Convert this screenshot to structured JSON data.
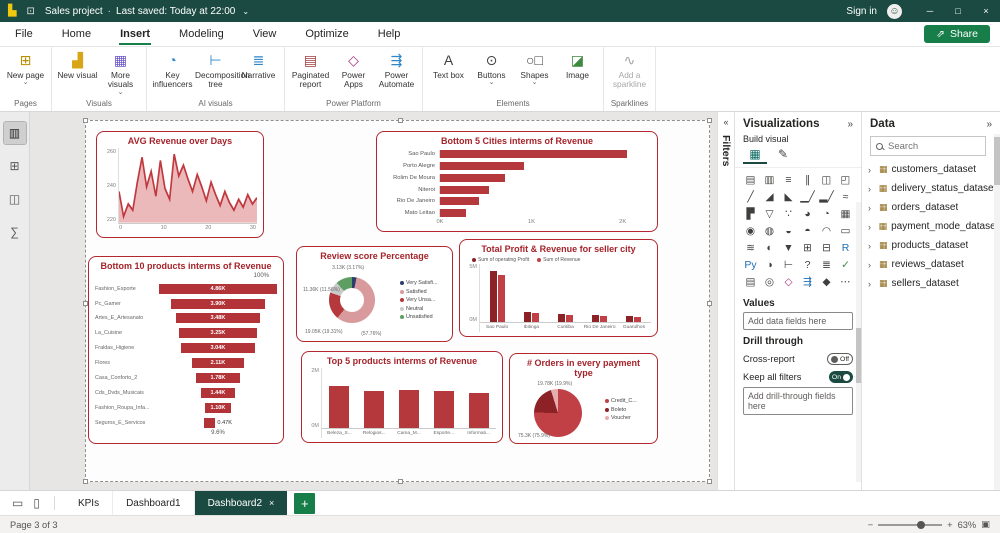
{
  "titlebar": {
    "app_title": "Sales project",
    "separator": "·",
    "autosave_text": "Last saved: Today at 22:00",
    "sign_in_label": "Sign in"
  },
  "menu": {
    "items": [
      "File",
      "Home",
      "Insert",
      "Modeling",
      "View",
      "Optimize",
      "Help"
    ],
    "active": "Insert",
    "share_label": "Share"
  },
  "ribbon": {
    "groups": [
      {
        "label": "Pages",
        "buttons": [
          {
            "label": "New page",
            "icon": "new-page-icon"
          }
        ]
      },
      {
        "label": "Visuals",
        "buttons": [
          {
            "label": "New visual",
            "icon": "new-visual-icon"
          },
          {
            "label": "More visuals",
            "icon": "more-visuals-icon"
          }
        ]
      },
      {
        "label": "AI visuals",
        "buttons": [
          {
            "label": "Key influencers",
            "icon": "key-influencers-icon"
          },
          {
            "label": "Decomposition tree",
            "icon": "decomposition-tree-icon"
          },
          {
            "label": "Narrative",
            "icon": "narrative-icon"
          }
        ]
      },
      {
        "label": "Power Platform",
        "buttons": [
          {
            "label": "Paginated report",
            "icon": "paginated-report-icon"
          },
          {
            "label": "Power Apps",
            "icon": "power-apps-icon"
          },
          {
            "label": "Power Automate",
            "icon": "power-automate-icon"
          }
        ]
      },
      {
        "label": "Elements",
        "buttons": [
          {
            "label": "Text box",
            "icon": "text-box-icon"
          },
          {
            "label": "Buttons",
            "icon": "buttons-icon"
          },
          {
            "label": "Shapes",
            "icon": "shapes-icon"
          },
          {
            "label": "Image",
            "icon": "image-icon"
          }
        ]
      },
      {
        "label": "Sparklines",
        "buttons": [
          {
            "label": "Add a sparkline",
            "icon": "sparkline-icon"
          }
        ]
      }
    ]
  },
  "dashboard": {
    "charts": [
      {
        "id": "avg-revenue-over-days",
        "type": "area",
        "title": "AVG Revenue over Days",
        "y_ticks": [
          220,
          240,
          260
        ],
        "x_ticks": [
          0,
          10,
          20,
          30
        ],
        "ylim": [
          218,
          266
        ],
        "stroke": "#c0393f",
        "fill": "#ecb9bb",
        "values": [
          238,
          222,
          230,
          226,
          244,
          260,
          241,
          251,
          235,
          258,
          240,
          233,
          262,
          248,
          255,
          246,
          238,
          249,
          241,
          232,
          244,
          236,
          229,
          238,
          231,
          226,
          233,
          228,
          236,
          230,
          234
        ]
      },
      {
        "id": "bottom-5-cities-revenue",
        "type": "hbar",
        "title": "Bottom 5 Cities interms of Revenue",
        "categories": [
          "Sao Paulo",
          "Porto Alegre",
          "Rolim De Moura",
          "Niteroi",
          "Rio De Janeiro",
          "Mato Leitao"
        ],
        "values": [
          2.05,
          0.92,
          0.71,
          0.54,
          0.43,
          0.28
        ],
        "bar_color": "#b5383c",
        "x_ticks": [
          "0K",
          "1K",
          "2K"
        ],
        "x_tick_vals": [
          0,
          1,
          2
        ],
        "xlim": [
          0,
          2.2
        ]
      },
      {
        "id": "bottom-10-products-revenue",
        "type": "funnel",
        "title": "Bottom 10 products interms of Revenue",
        "categories": [
          "Fashion_Esporte",
          "Pc_Gamer",
          "Artes_E_Artesanato",
          "La_Cuisine",
          "Fraldas_Higiene",
          "Flores",
          "Casa_Conforto_2",
          "Cds_Dvds_Musicais",
          "Fashion_Roupa_Infa...",
          "Seguros_E_Servicos"
        ],
        "labels": [
          "4.86K",
          "3.90K",
          "3.48K",
          "3.25K",
          "3.04K",
          "2.11K",
          "1.78K",
          "1.44K",
          "1.10K",
          "0.47K"
        ],
        "values": [
          4.86,
          3.9,
          3.48,
          3.25,
          3.04,
          2.11,
          1.78,
          1.44,
          1.1,
          0.47
        ],
        "bar_color": "#b23338",
        "top_label": "100%",
        "bottom_label": "9.6%"
      },
      {
        "id": "review-score-percentage",
        "type": "donut",
        "title": "Review score Percentage",
        "slices": [
          {
            "pct": 3.17,
            "color": "#2c3e6b"
          },
          {
            "pct": 57.76,
            "color": "#d89a9c"
          },
          {
            "pct": 19.31,
            "color": "#b5383c"
          },
          {
            "pct": 8.2,
            "color": "#c9c9c7"
          },
          {
            "pct": 11.56,
            "color": "#5f9e62"
          }
        ],
        "point_labels": [
          "3.13K (3.17%)",
          "11.36K (11.56%)",
          "19.05K (19.31%)",
          "(57.76%)"
        ],
        "legend": [
          "Very Satisfi...",
          "Satisfied",
          "Very Unsa...",
          "Neutral",
          "Unsatisfied"
        ],
        "legend_colors": [
          "#2c3e6b",
          "#d89a9c",
          "#b5383c",
          "#c9c9c7",
          "#5f9e62"
        ]
      },
      {
        "id": "total-profit-revenue-seller-city",
        "type": "grouped-column",
        "title": "Total Profit & Revenue for seller city",
        "legend": [
          "Sum of operating Profit",
          "Sum of Revenue"
        ],
        "legend_colors": [
          "#8c2226",
          "#c04046"
        ],
        "categories": [
          "Sao Paulo",
          "Ibitinga",
          "Curitiba",
          "Rio De Janeiro",
          "Guarulhos"
        ],
        "series": [
          {
            "name": "Sum of operating Profit",
            "values": [
              4.9,
              1.0,
              0.8,
              0.7,
              0.6
            ]
          },
          {
            "name": "Sum of Revenue",
            "values": [
              4.5,
              0.85,
              0.7,
              0.6,
              0.5
            ]
          }
        ],
        "y_ticks": [
          "5M",
          "0M"
        ],
        "ylim": [
          0,
          5.5
        ]
      },
      {
        "id": "top-5-products-revenue",
        "type": "column",
        "title": "Top 5 products interms of Revenue",
        "categories": [
          "Beleza_S...",
          "Relogios...",
          "Cama_M...",
          "Esporte...",
          "Informati..."
        ],
        "values": [
          1.55,
          1.38,
          1.42,
          1.36,
          1.3
        ],
        "bar_color": "#b5383c",
        "y_ticks": [
          "2M",
          "0M"
        ],
        "ylim": [
          0,
          2.2
        ]
      },
      {
        "id": "orders-per-payment-type",
        "type": "pie",
        "title": "# Orders in every payment type",
        "slices": [
          {
            "pct": 75.3,
            "color": "#c04046"
          },
          {
            "pct": 19.9,
            "color": "#8c2226"
          },
          {
            "pct": 4.8,
            "color": "#e5adaf"
          }
        ],
        "point_labels": [
          "19.78K (19.9%)",
          "75.3K (75.9%)"
        ],
        "legend": [
          "Credit_C...",
          "Boleto",
          "Voucher"
        ],
        "legend_colors": [
          "#c04046",
          "#8c2226",
          "#e5adaf"
        ]
      }
    ]
  },
  "filters": {
    "title": "Filters"
  },
  "visualizations": {
    "title": "Visualizations",
    "build_label": "Build visual",
    "values_label": "Values",
    "values_placeholder": "Add data fields here",
    "drill_label": "Drill through",
    "cross_report": "Cross-report",
    "cross_report_state": "Off",
    "keep_filters": "Keep all filters",
    "keep_filters_state": "On",
    "drill_placeholder": "Add drill-through fields here",
    "icon_grid": [
      {
        "name": "stacked-bar-chart-icon",
        "glyph": "▤"
      },
      {
        "name": "stacked-column-chart-icon",
        "glyph": "▥"
      },
      {
        "name": "clustered-bar-chart-icon",
        "glyph": "≡"
      },
      {
        "name": "clustered-column-chart-icon",
        "glyph": "∥"
      },
      {
        "name": "100-stacked-bar-chart-icon",
        "glyph": "◫"
      },
      {
        "name": "100-stacked-column-chart-icon",
        "glyph": "◰"
      },
      {
        "name": "line-chart-icon",
        "glyph": "╱"
      },
      {
        "name": "area-chart-icon",
        "glyph": "◢"
      },
      {
        "name": "stacked-area-chart-icon",
        "glyph": "◣"
      },
      {
        "name": "line-clustered-column-chart-icon",
        "glyph": "▁╱"
      },
      {
        "name": "line-stacked-column-chart-icon",
        "glyph": "▂╱"
      },
      {
        "name": "ribbon-chart-icon",
        "glyph": "≈"
      },
      {
        "name": "waterfall-chart-icon",
        "glyph": "▛"
      },
      {
        "name": "funnel-chart-icon",
        "glyph": "▽"
      },
      {
        "name": "scatter-chart-icon",
        "glyph": "∵"
      },
      {
        "name": "pie-chart-icon",
        "glyph": "◕"
      },
      {
        "name": "donut-chart-icon",
        "glyph": "◔"
      },
      {
        "name": "treemap-icon",
        "glyph": "▦"
      },
      {
        "name": "map-icon",
        "glyph": "◉"
      },
      {
        "name": "filled-map-icon",
        "glyph": "◍"
      },
      {
        "name": "shape-map-icon",
        "glyph": "◒"
      },
      {
        "name": "azure-map-icon",
        "glyph": "◓"
      },
      {
        "name": "gauge-icon",
        "glyph": "◠"
      },
      {
        "name": "card-icon",
        "glyph": "▭"
      },
      {
        "name": "multi-row-card-icon",
        "glyph": "≋"
      },
      {
        "name": "kpi-icon",
        "glyph": "◐"
      },
      {
        "name": "slicer-icon",
        "glyph": "▼"
      },
      {
        "name": "table-visual-icon",
        "glyph": "⊞"
      },
      {
        "name": "matrix-visual-icon",
        "glyph": "⊟"
      },
      {
        "name": "r-script-visual-icon",
        "glyph": "R",
        "color": "#1f6fb5"
      },
      {
        "name": "python-visual-icon",
        "glyph": "Py",
        "color": "#1f6fb5"
      },
      {
        "name": "key-influencers-visual-icon",
        "glyph": "◑"
      },
      {
        "name": "decomposition-tree-visual-icon",
        "glyph": "⊢"
      },
      {
        "name": "qa-visual-icon",
        "glyph": "?"
      },
      {
        "name": "narrative-visual-icon",
        "glyph": "≣"
      },
      {
        "name": "metrics-visual-icon",
        "glyph": "✓",
        "color": "#3b8a3e"
      },
      {
        "name": "paginated-report-visual-icon",
        "glyph": "▤"
      },
      {
        "name": "arcgis-map-icon",
        "glyph": "◎"
      },
      {
        "name": "power-apps-visual-icon",
        "glyph": "◇",
        "color": "#a8327d"
      },
      {
        "name": "power-automate-visual-icon",
        "glyph": "⇶",
        "color": "#1f6fb5"
      },
      {
        "name": "custom-visual-icon",
        "glyph": "◆"
      },
      {
        "name": "more-visuals-options-icon",
        "glyph": "⋯"
      }
    ]
  },
  "datapane": {
    "title": "Data",
    "search_placeholder": "Search",
    "fields": [
      "customers_dataset",
      "delivery_status_dataset",
      "orders_dataset",
      "payment_mode_dataset",
      "products_dataset",
      "reviews_dataset",
      "sellers_dataset"
    ]
  },
  "tabs": {
    "pages": [
      "KPIs",
      "Dashboard1",
      "Dashboard2"
    ],
    "active": "Dashboard2"
  },
  "statusbar": {
    "page_indicator": "Page 3 of 3",
    "zoom_level": "63%"
  },
  "theme": {
    "titlebar": "#1b4a42",
    "accent_green": "#177d49",
    "chart_red": "#b5383c",
    "chart_border": "#b2282e"
  },
  "icons": {
    "app-logo-icon": {
      "glyph": "▙",
      "color": "#f2c80f"
    },
    "save-icon": {
      "glyph": "⊡",
      "color": "#e8e8e8"
    },
    "title-chevron-icon": {
      "glyph": "⌄",
      "color": "#ffffff"
    },
    "avatar-icon": {
      "glyph": "☺",
      "color": "#1b4a42"
    },
    "minimize-icon": {
      "glyph": "─",
      "color": "#ffffff"
    },
    "maximize-icon": {
      "glyph": "□",
      "color": "#ffffff"
    },
    "close-icon": {
      "glyph": "×",
      "color": "#ffffff"
    },
    "share-icon": {
      "glyph": "⇗",
      "color": "#ffffff"
    },
    "dropdown-chevron-icon": {
      "glyph": "⌄",
      "color": "#666666"
    },
    "new-page-icon": {
      "glyph": "⊞",
      "color": "#b98f00"
    },
    "new-visual-icon": {
      "glyph": "▟",
      "color": "#d8a517"
    },
    "more-visuals-icon": {
      "glyph": "▦",
      "color": "#6b57c9"
    },
    "key-influencers-icon": {
      "glyph": "◔",
      "color": "#2f86c8"
    },
    "decomposition-tree-icon": {
      "glyph": "⊢",
      "color": "#2f86c8"
    },
    "narrative-icon": {
      "glyph": "≣",
      "color": "#2f86c8"
    },
    "paginated-report-icon": {
      "glyph": "▤",
      "color": "#9e3a38"
    },
    "power-apps-icon": {
      "glyph": "◇",
      "color": "#a8327d"
    },
    "power-automate-icon": {
      "glyph": "⇶",
      "color": "#2f86c8"
    },
    "text-box-icon": {
      "glyph": "A",
      "color": "#3f3f3d"
    },
    "buttons-icon": {
      "glyph": "⊙",
      "color": "#3f3f3d"
    },
    "shapes-icon": {
      "glyph": "○□",
      "color": "#3f3f3d"
    },
    "image-icon": {
      "glyph": "◪",
      "color": "#3b8a3e"
    },
    "sparkline-icon": {
      "glyph": "∿",
      "color": "#a6a6a6"
    },
    "report-view-icon": {
      "glyph": "▥",
      "color": "#252423"
    },
    "table-view-icon": {
      "glyph": "⊞",
      "color": "#5a5a58"
    },
    "model-view-icon": {
      "glyph": "◫",
      "color": "#5a5a58"
    },
    "dax-query-view-icon": {
      "glyph": "∑",
      "color": "#5a5a58"
    },
    "expand-filters-icon": {
      "glyph": "«",
      "color": "#444444"
    },
    "collapse-pane-icon": {
      "glyph": "»",
      "color": "#444444"
    },
    "build-visual-icon": {
      "glyph": "▦",
      "color": "#0d6a64"
    },
    "format-visual-icon": {
      "glyph": "✎",
      "color": "#3f3f3d"
    },
    "chevron-right-icon": {
      "glyph": "›",
      "color": "#555555"
    },
    "table-icon": {
      "glyph": "▦",
      "color": "#8f6c1f"
    },
    "desktop-layout-icon": {
      "glyph": "▭",
      "color": "#555555"
    },
    "mobile-layout-icon": {
      "glyph": "▯",
      "color": "#555555"
    },
    "tab-close-icon": {
      "glyph": "×",
      "color": "#ffffff"
    },
    "add-page-icon": {
      "glyph": "+",
      "color": "#ffffff"
    },
    "zoom-out-icon": {
      "glyph": "−",
      "color": "#555555"
    },
    "zoom-in-icon": {
      "glyph": "+",
      "color": "#555555"
    },
    "fit-page-icon": {
      "glyph": "▣",
      "color": "#555555"
    }
  }
}
